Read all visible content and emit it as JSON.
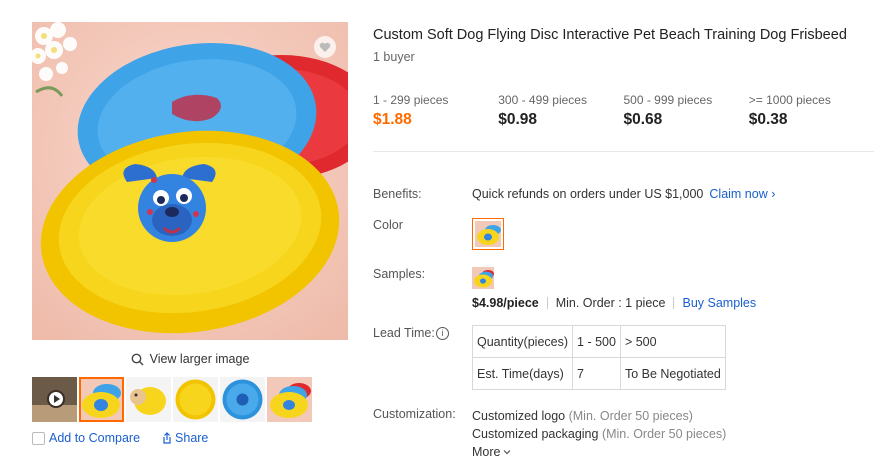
{
  "product": {
    "title": "Custom Soft Dog Flying Disc Interactive Pet Beach Training Dog Frisbeed",
    "buyers": "1 buyer"
  },
  "gallery": {
    "view_larger": "Q View larger image",
    "view_larger_text": "View larger image",
    "add_to_compare": "Add to Compare",
    "share": "Share"
  },
  "tiers": [
    {
      "range": "1 - 299 pieces",
      "price": "$1.88"
    },
    {
      "range": "300 - 499 pieces",
      "price": "$0.98"
    },
    {
      "range": "500 - 999 pieces",
      "price": "$0.68"
    },
    {
      "range": ">= 1000 pieces",
      "price": "$0.38"
    }
  ],
  "benefits": {
    "label": "Benefits:",
    "text": "Quick refunds on orders under US $1,000",
    "claim": "Claim now ›"
  },
  "color": {
    "label": "Color"
  },
  "samples": {
    "label": "Samples:",
    "price": "$4.98/piece",
    "min_order": "Min. Order : 1 piece",
    "buy": "Buy Samples"
  },
  "lead_time": {
    "label": "Lead Time:",
    "rows": [
      [
        "Quantity(pieces)",
        "1 - 500",
        "> 500"
      ],
      [
        "Est. Time(days)",
        "7",
        "To Be Negotiated"
      ]
    ]
  },
  "customization": {
    "label": "Customization:",
    "items": [
      {
        "name": "Customized logo",
        "note": "(Min. Order 50 pieces)"
      },
      {
        "name": "Customized packaging",
        "note": "(Min. Order 50 pieces)"
      }
    ],
    "more": "More"
  },
  "colors": {
    "accent": "#ff6a00",
    "link": "#1a5fd0",
    "frisbee_yellow": "#f7d51d",
    "frisbee_blue": "#3fa3e8",
    "frisbee_red": "#e0282f"
  }
}
